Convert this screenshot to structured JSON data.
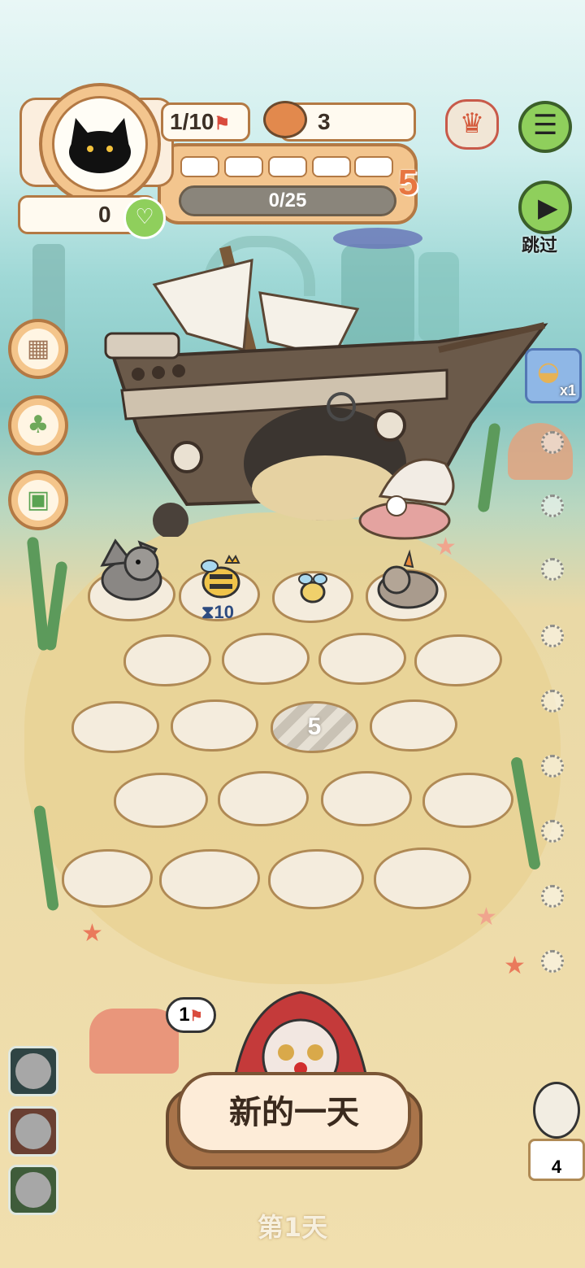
{
  "hud": {
    "pet_count": "1/10",
    "coin_count": "3",
    "heart_count": "0",
    "level": "5",
    "progress_text": "0/25",
    "progress_value": 0
  },
  "top_right": {
    "skip_label": "跳过"
  },
  "right_item": {
    "bowl_count": "x1"
  },
  "board": {
    "wait_timer": "10",
    "locked_tile_cost": "5",
    "flag_bubble": "1"
  },
  "bottom": {
    "new_day_label": "新的一天",
    "day_label": "第1天",
    "kiwi_count": "4"
  },
  "colors": {
    "accent_orange": "#e77641",
    "panel_tan": "#f3c58e",
    "green_button": "#8fcf5c"
  },
  "icons": [
    "cat-avatar-icon",
    "flag-icon",
    "coin-bowl-icon",
    "heart-icon",
    "menu-icon",
    "play-icon",
    "jester-badge-icon",
    "box-icon",
    "sprout-icon",
    "gameboy-icon",
    "bowl-item-icon"
  ]
}
